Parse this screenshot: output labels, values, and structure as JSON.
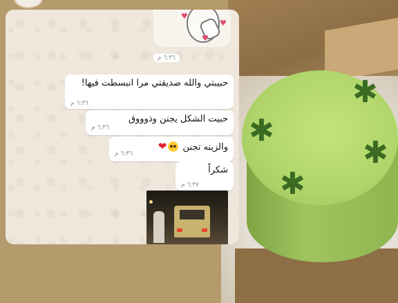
{
  "messages": [
    {
      "text": "حبيبتي والله صديقتي مرا انبسطت فيها!",
      "time": "٦:٣٦ م"
    },
    {
      "text": "حبيت الشكل يجنن وذوووق",
      "time": "٦:٣٦ م"
    },
    {
      "text": "والزينه تجنن",
      "emoji": [
        "face-holding-back-tears",
        "red-heart"
      ],
      "time": "٦:٣٦ م"
    },
    {
      "text": "شكراً",
      "time": "٦:٣٧ م"
    }
  ],
  "sticker": {
    "time": "٦:٣٦ م"
  },
  "colors": {
    "chat_background": "#efe7dc",
    "bubble": "#ffffff",
    "timestamp": "#8e8e8e",
    "cake_green": "#afd56a"
  }
}
